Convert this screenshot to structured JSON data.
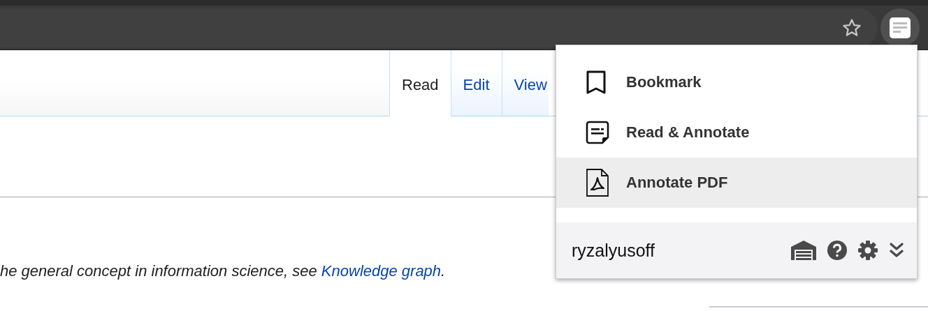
{
  "wiki": {
    "tabs": [
      {
        "label": "Read",
        "selected": true
      },
      {
        "label": "Edit",
        "selected": false
      },
      {
        "label": "View",
        "selected": false
      }
    ],
    "hatnote": {
      "text": "he general concept in information science, see ",
      "link": "Knowledge graph",
      "after": "."
    }
  },
  "popup": {
    "items": [
      {
        "label": "Bookmark",
        "kind": "bookmark",
        "selected": false
      },
      {
        "label": "Read & Annotate",
        "kind": "note",
        "selected": false
      },
      {
        "label": "Annotate PDF",
        "kind": "pdf",
        "selected": true
      }
    ],
    "username": "ryzalyusoff"
  }
}
